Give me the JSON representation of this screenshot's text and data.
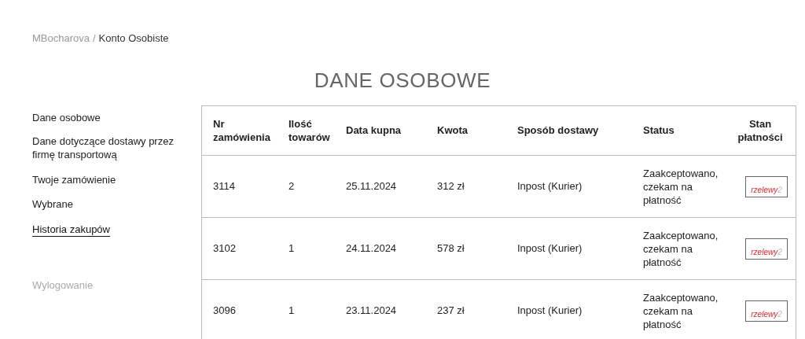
{
  "breadcrumb": {
    "parent": "MBocharova",
    "separator": "/",
    "current": "Konto Osobiste"
  },
  "title": "DANE OSOBOWE",
  "sidebar": {
    "items": [
      {
        "label": "Dane osobowe",
        "selected": false
      },
      {
        "label": "Dane dotyczące dostawy przez firmę transportową",
        "selected": false
      },
      {
        "label": "Twoje zamówienie",
        "selected": false
      },
      {
        "label": "Wybrane",
        "selected": false
      },
      {
        "label": "Historia zakupów",
        "selected": true
      }
    ],
    "logout": "Wylogowanie"
  },
  "table": {
    "columns": [
      "Nr zamówienia",
      "Ilość towarów",
      "Data kupna",
      "Kwota",
      "Sposób dostawy",
      "Status",
      "Stan płatności"
    ],
    "rows": [
      {
        "cells": [
          "3114",
          "2",
          "25.11.2024",
          "312 zł",
          "Inpost (Kurier)",
          "Zaakceptowano, czekam na płatność"
        ],
        "payment": {
          "name": "rzelewy",
          "suffix": "2"
        }
      },
      {
        "cells": [
          "3102",
          "1",
          "24.11.2024",
          "578 zł",
          "Inpost (Kurier)",
          "Zaakceptowano, czekam na płatność"
        ],
        "payment": {
          "name": "rzelewy",
          "suffix": "2"
        }
      },
      {
        "cells": [
          "3096",
          "1",
          "23.11.2024",
          "237 zł",
          "Inpost (Kurier)",
          "Zaakceptowano, czekam na płatność"
        ],
        "payment": {
          "name": "rzelewy",
          "suffix": "2"
        }
      }
    ]
  }
}
